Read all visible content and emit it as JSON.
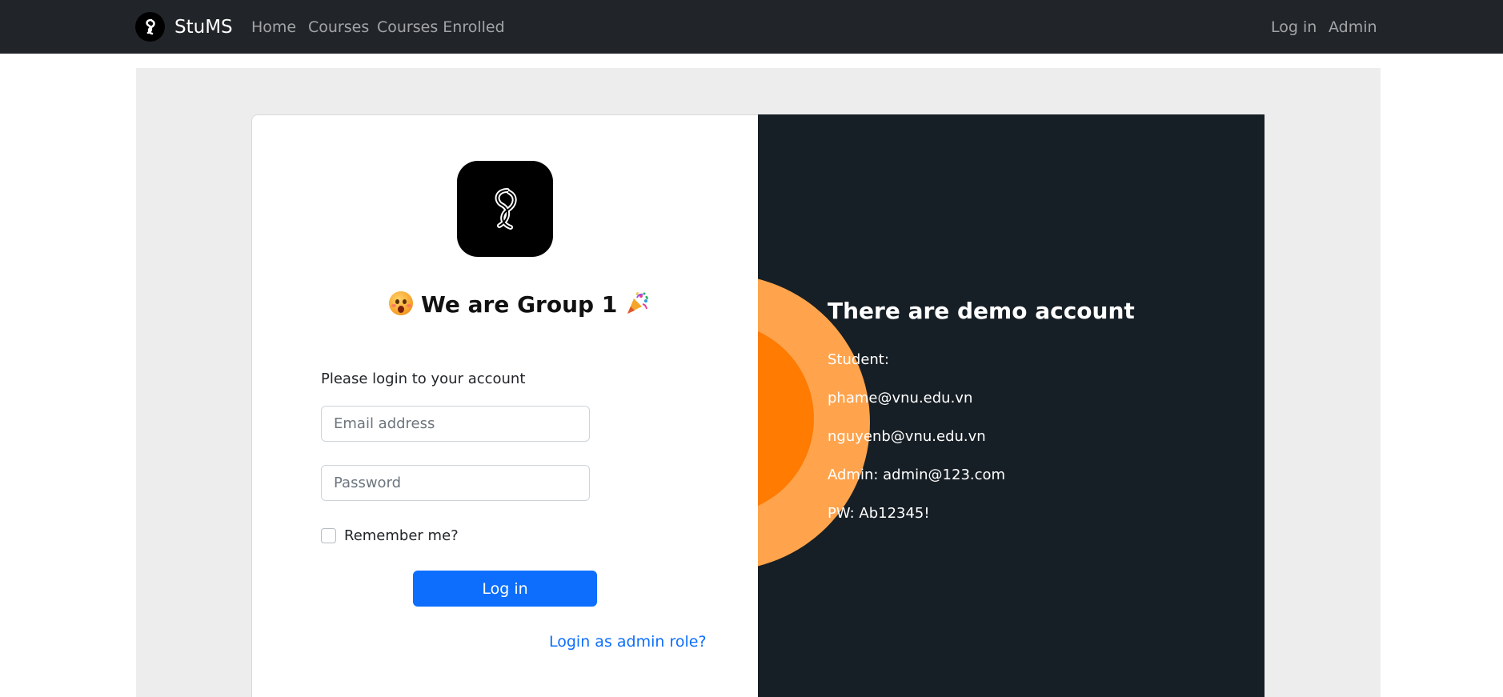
{
  "navbar": {
    "brand": "StuMS",
    "links": [
      "Home",
      "Courses",
      "Courses Enrolled"
    ],
    "right_links": [
      "Log in",
      "Admin"
    ]
  },
  "login": {
    "title": "We are Group 1",
    "title_left_emoji": "astonished-face-icon",
    "title_right_emoji": "party-popper-icon",
    "hint": "Please login to your account",
    "email_placeholder": "Email address",
    "email_value": "",
    "password_placeholder": "Password",
    "password_value": "",
    "remember_label": "Remember me?",
    "remember_checked": false,
    "login_button": "Log in",
    "admin_link": "Login as admin role?"
  },
  "demo": {
    "heading": "There are demo account",
    "lines": [
      "Student:",
      "phame@vnu.edu.vn",
      "nguyenb@vnu.edu.vn",
      "Admin: admin@123.com",
      "PW: Ab12345!"
    ]
  },
  "colors": {
    "navbar_bg": "#212529",
    "primary": "#0d6efd",
    "panel_dark": "#171f26",
    "circle_outer": "#ffa44d",
    "circle_inner": "#ff7b02"
  }
}
